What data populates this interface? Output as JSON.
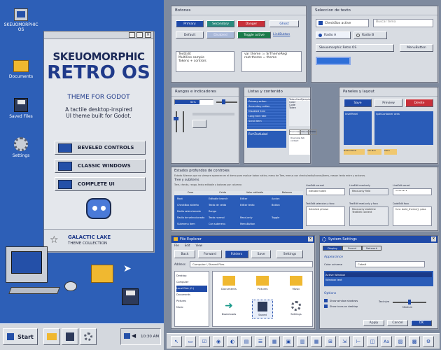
{
  "desktop": {
    "icons": [
      {
        "label": "SKEUOMORPHIC OS"
      },
      {
        "label": "Documents"
      },
      {
        "label": "Saved Files"
      },
      {
        "label": "Settings"
      }
    ]
  },
  "hero": {
    "logo_top": "SKEUOMORPHIC",
    "logo_bottom": "RETRO OS",
    "subtitle": "THEME FOR GODOT",
    "desc_line1": "A tactile desktop-inspired",
    "desc_line2": "UI theme built for Godot.",
    "features": [
      "BEVELED CONTROLS",
      "CLASSIC WINDOWS",
      "COMPLETE UI"
    ],
    "footer_title": "GALACTIC LAKE",
    "footer_sub": "THEME COLLECTION"
  },
  "taskbar": {
    "start": "Start",
    "clock": "10:30 AM"
  },
  "botones": {
    "title": "Botones",
    "primary": "Primary",
    "secondary": "Secondary",
    "danger": "Danger",
    "ghost": "Ghost",
    "default": "Default",
    "disabled": "Disabled",
    "toggle": "Toggle active",
    "link": "LinkButton",
    "textedit": [
      "TextEdit",
      "Multiline sample",
      "Tokens + controls"
    ],
    "code": [
      "var theme := SrThemeRegi",
      "root.theme = theme"
    ]
  },
  "seleccion": {
    "title": "Seleccion de texto",
    "checkbox": "CheckBox active",
    "search_placeholder": "Buscar tema",
    "radio_a": "Radio A",
    "radio_b": "Radio B",
    "option": "Skeuomorphic Retro OS",
    "menubutton": "MenuButton"
  },
  "rangos": {
    "title": "Rangos e indicadores",
    "progress_label": "64%",
    "progress_value": 0.64
  },
  "listas": {
    "title": "Listas y contenido",
    "items": [
      "Primary action",
      "Secondary action",
      "Disabled item",
      "Long item title",
      "Scroll item"
    ],
    "tree_cols": [
      "Token",
      "Uso",
      "Ejemplo"
    ],
    "tree_rows": [
      "Color",
      "Code",
      "Token"
    ],
    "rich": "RichTextLabel",
    "tabs": [
      "Overview",
      "Tokens",
      "States"
    ],
    "tab_content": "Overview tab content"
  },
  "paneles": {
    "title": "Paneles y layout",
    "save": "Save",
    "preview": "Preview",
    "delete": "Delete",
    "inset": "InsetPanel",
    "split": "SplitContainer area",
    "tags": [
      "ButtonPanel",
      "Ctrl Box",
      "Menu"
    ]
  },
  "estados": {
    "title": "Estados profundos de controles",
    "desc": "Estado Alternos que no siempre aparecen en el demo para evaluar boton nativo, menu de Tree, menus con checks/radio/iconos/items, reason texto entre y acciones.",
    "tree_title": "Tree y subitems",
    "tree_desc": "Tree, checks, rango, texto editable y botones por columna",
    "cols": [
      "Caso",
      "Celda",
      "Valor editable",
      "Botones"
    ],
    "rows": [
      [
        "Root",
        "Editable branch",
        "Editar",
        "Accion"
      ],
      [
        "CheckBox abierto",
        "Texto de celda",
        "Editar texto",
        "Button"
      ],
      [
        "Radio seleccionado",
        "Rango",
        "",
        ""
      ],
      [
        "Radio de seleccionado",
        "Texto normal",
        "Read-only",
        "Toggle"
      ],
      [
        "Submenu item",
        "Con submenu",
        "MenuButton",
        ""
      ]
    ],
    "side_inputs": [
      {
        "label": "LineEdit normal",
        "value": "Editable token"
      },
      {
        "label": "LineEdit read-only",
        "value": "Read-only field"
      },
      {
        "label": "LineEdit secret",
        "value": "••••••••"
      }
    ],
    "side_text": [
      {
        "label": "TextEdit seleccion y foco",
        "value": "Selected phrase"
      },
      {
        "label": "TextEdit read-only y foco",
        "value": "Read-only stateline TextEdit content"
      },
      {
        "label": "CodeEdit foco",
        "value": "func build_theme(): pass"
      }
    ]
  },
  "explorer": {
    "title": "File Explorer",
    "menu": [
      "File",
      "Edit",
      "View"
    ],
    "toolbar": [
      "Back",
      "Forward",
      "Folders",
      "Save",
      "Settings"
    ],
    "address_label": "Address",
    "address": "Computer \\ Shared Files",
    "tree": [
      "Desktop",
      "Computer",
      "Local Disk (C:)",
      "Documents",
      "Pictures",
      "Music"
    ],
    "files": [
      "Documents",
      "Pictures",
      "Music",
      "Downloads",
      "Saved",
      "Settings"
    ]
  },
  "settings": {
    "title": "System Settings",
    "tabs": [
      "Display",
      "Sound",
      "Network"
    ],
    "appearance": "Appearance",
    "scheme_label": "Color scheme",
    "scheme": "Cobalt",
    "list": [
      "Active Window",
      "Window text"
    ],
    "options": "Options",
    "opt1": "Show window shadows",
    "opt2": "Show icons on desktop",
    "text_size": "Text size",
    "size_val": "Medium",
    "apply": "Apply",
    "cancel": "Cancel",
    "ok": "OK"
  },
  "colors": {
    "desktop": "#2d5fb7",
    "accent": "#1f4aa8",
    "danger": "#c8303a",
    "secondary": "#2a8a7e",
    "toggle": "#1a7a4a"
  }
}
